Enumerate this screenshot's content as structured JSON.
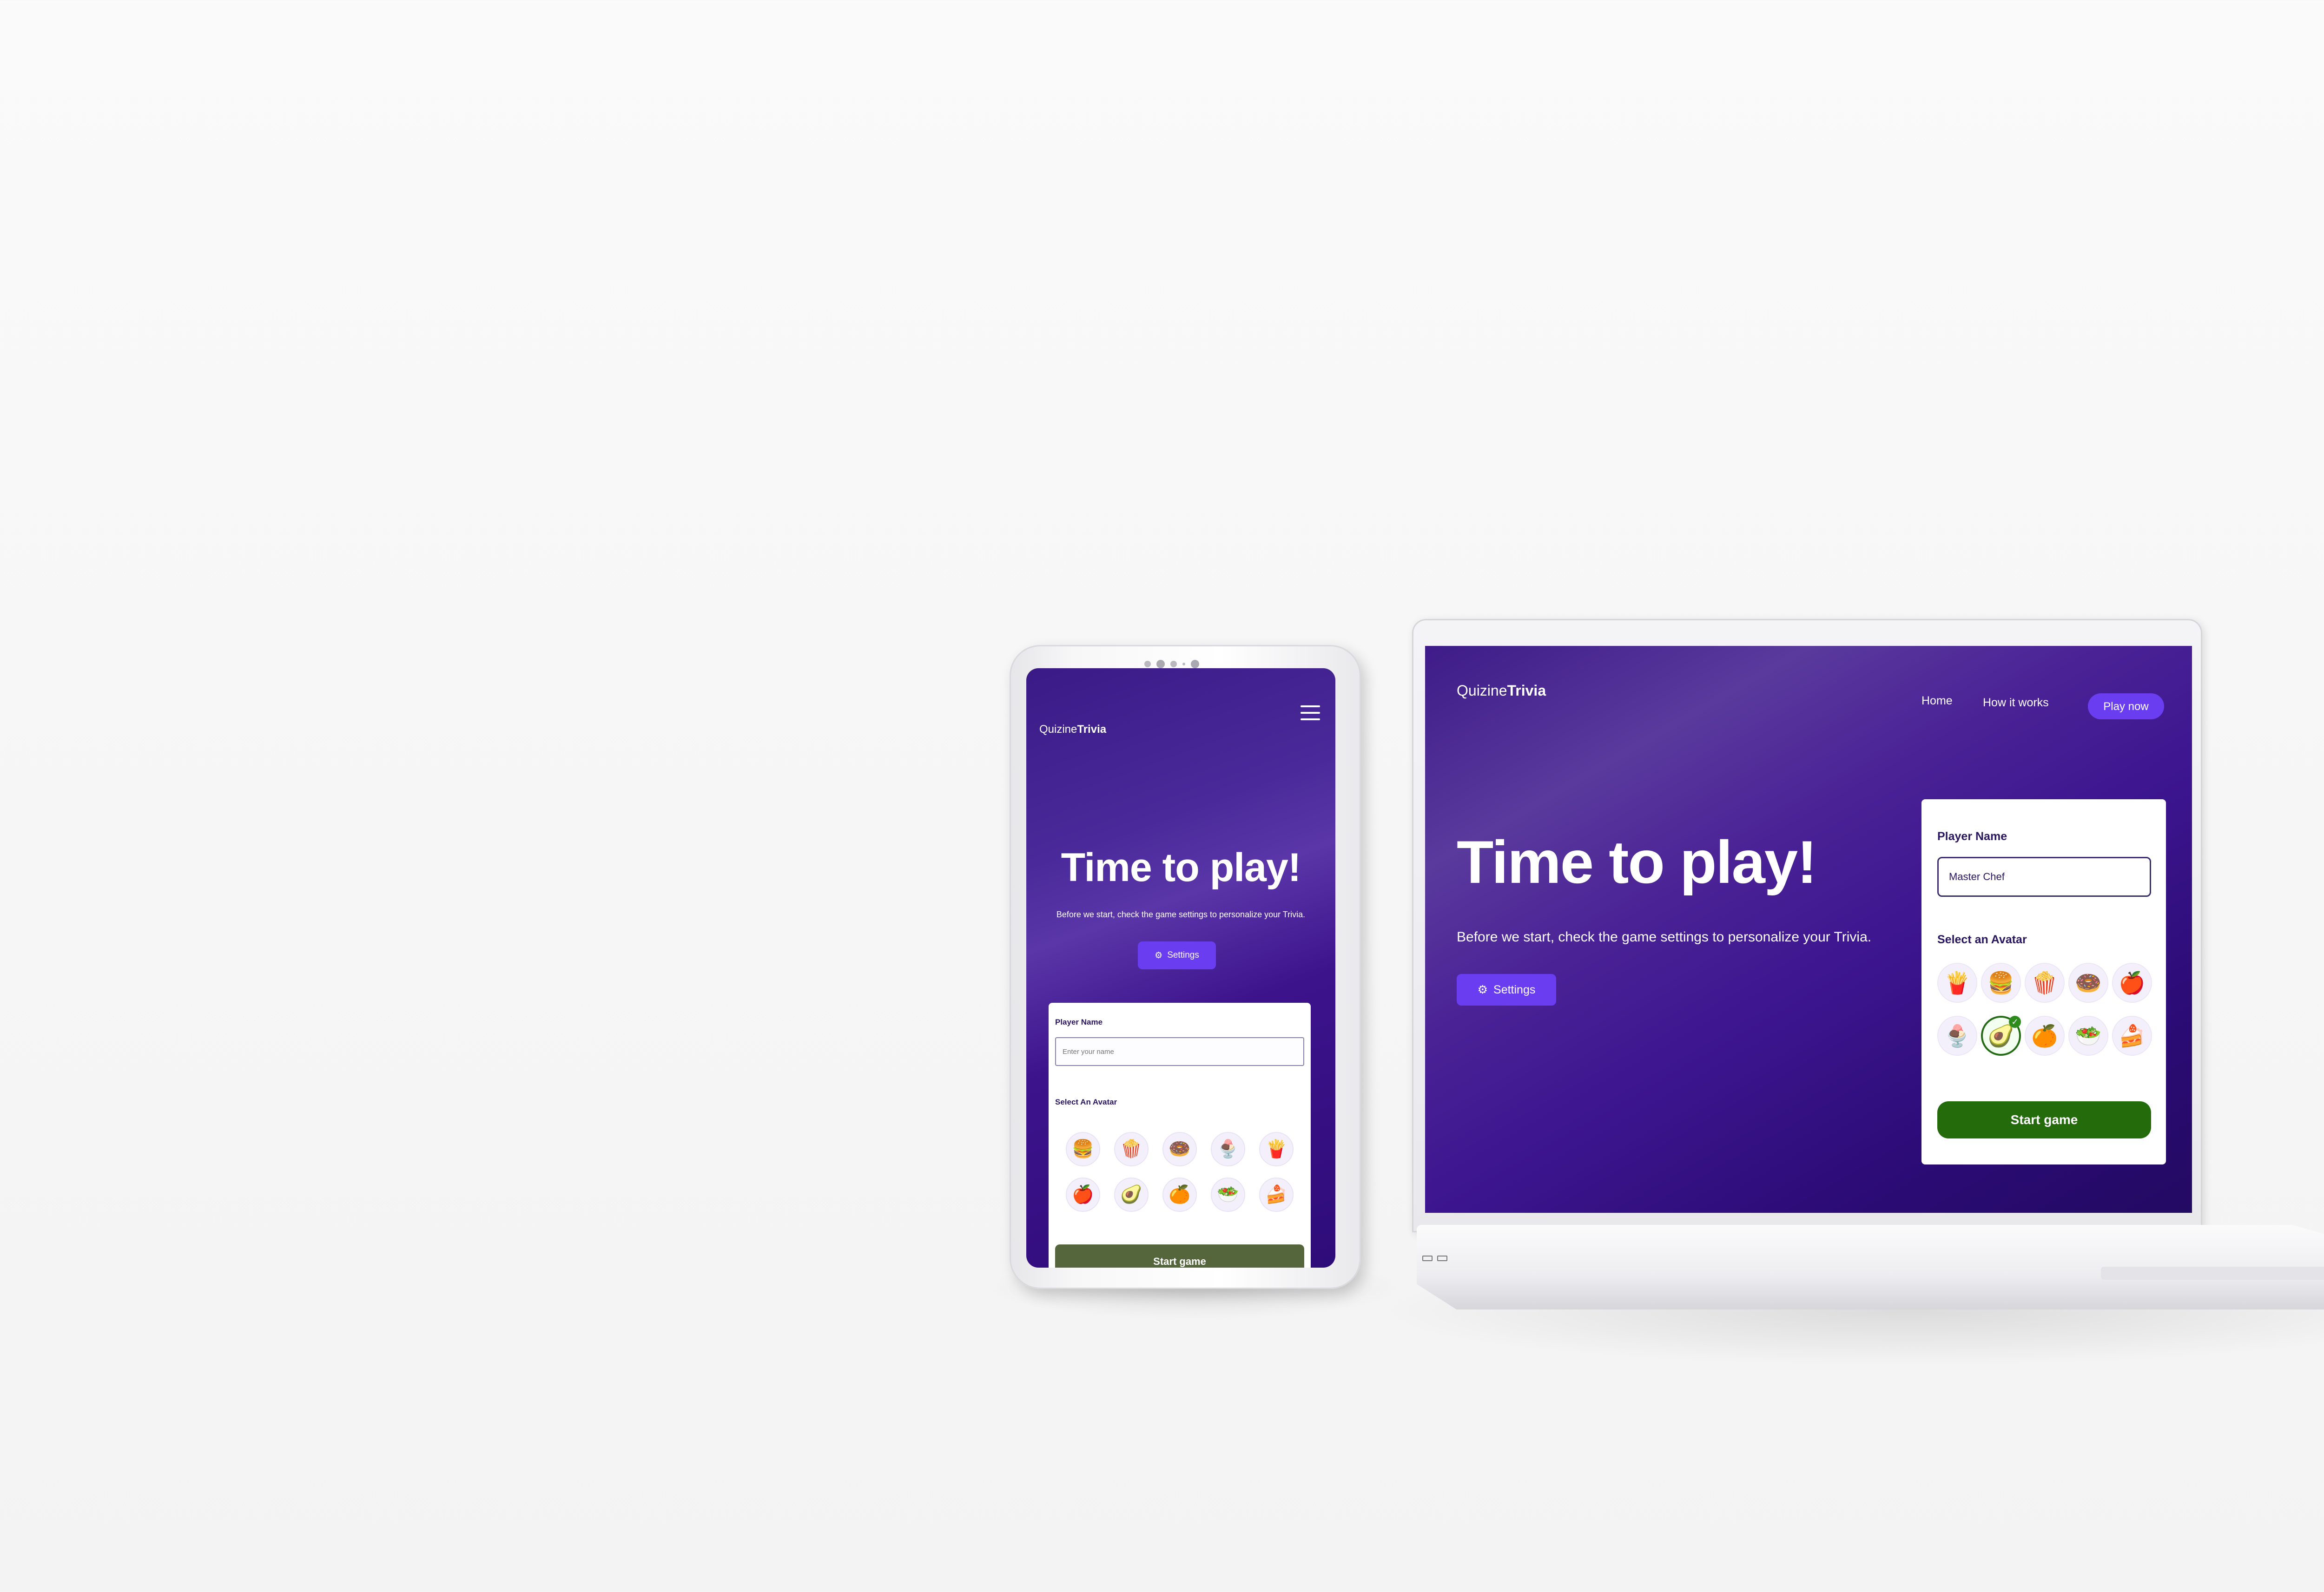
{
  "brand": {
    "prefix": "Quizine",
    "suffix": "Trivia"
  },
  "nav": {
    "home": "Home",
    "how": "How it works",
    "play": "Play now"
  },
  "hero": {
    "title": "Time to play!",
    "subtitle": "Before we start, check the game settings to personalize your Trivia.",
    "settings_label": "Settings"
  },
  "tablet_card": {
    "name_label": "Player Name",
    "name_placeholder": "Enter your name",
    "avatar_label": "Select An Avatar",
    "avatars": [
      "🍔",
      "🍿",
      "🍩",
      "🍨",
      "🍟",
      "🍎",
      "🥑",
      "🍊",
      "🥗",
      "🍰"
    ],
    "start_label": "Start game"
  },
  "laptop_card": {
    "name_label": "Player Name",
    "name_value": "Master Chef",
    "avatar_label": "Select an Avatar",
    "avatars": [
      "🍟",
      "🍔",
      "🍿",
      "🍩",
      "🍎",
      "🍨",
      "🥑",
      "🍊",
      "🥗",
      "🍰"
    ],
    "selected_avatar": "🥑",
    "start_label": "Start game"
  },
  "colors": {
    "accent": "#6a3df0",
    "start_green": "#246b0c",
    "background_purple": "#2e0c79"
  },
  "icons": {
    "settings": "gear-icon",
    "menu": "hamburger-menu-icon",
    "selected": "check-icon"
  }
}
